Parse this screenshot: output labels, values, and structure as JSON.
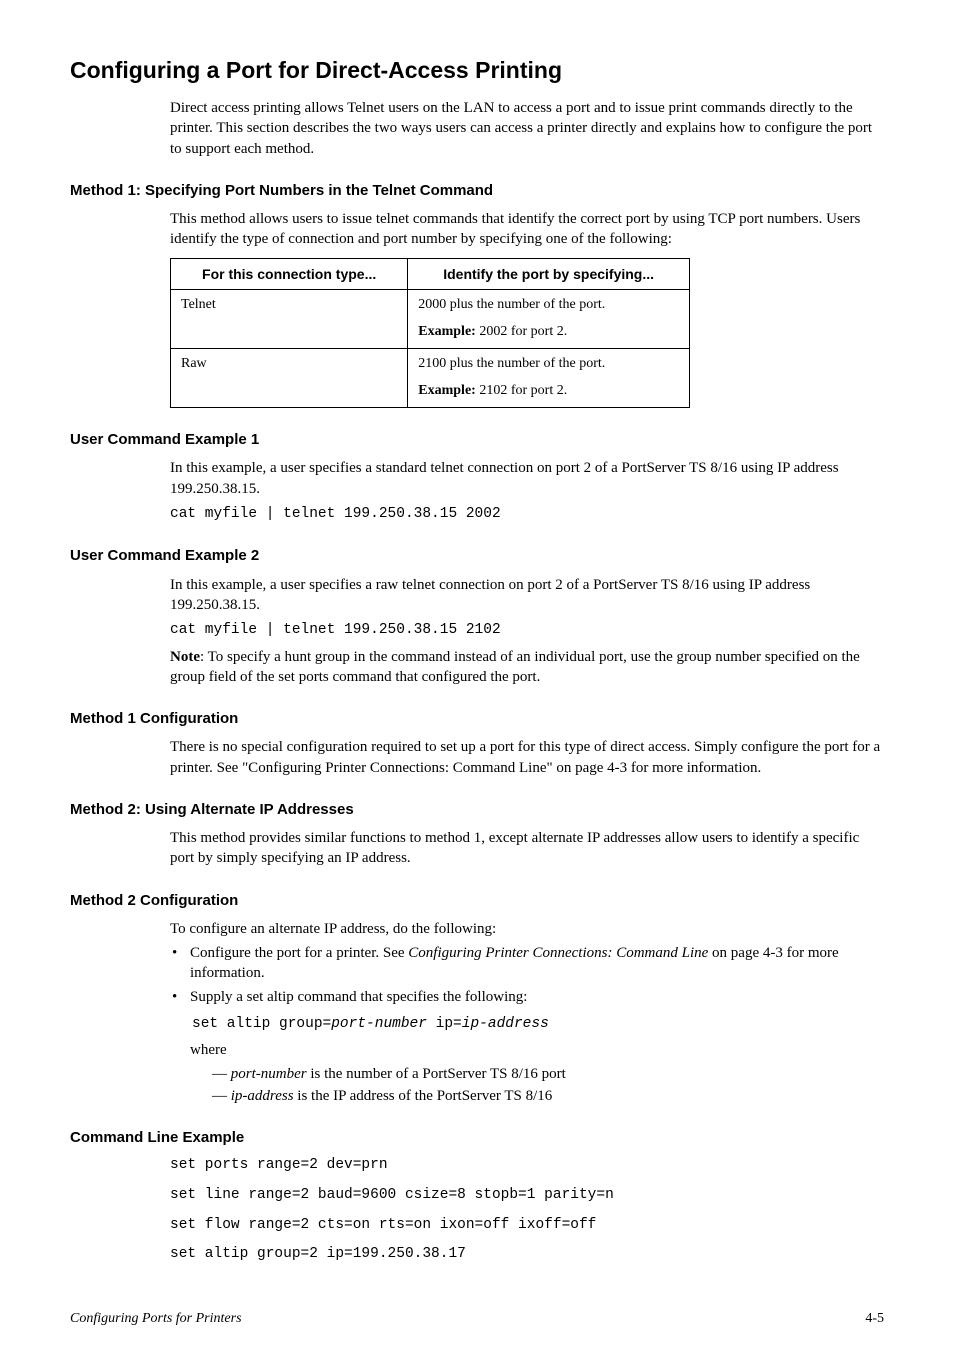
{
  "title": "Configuring a Port for Direct-Access Printing",
  "intro": "Direct access printing allows Telnet users on the LAN to access a port and to issue print commands directly to the printer. This section describes the two ways users can access a printer directly and explains how to configure the port to support each method.",
  "method1": {
    "heading": "Method 1: Specifying Port Numbers in the Telnet Command",
    "desc": "This method allows users to issue telnet commands that identify the correct port by using TCP port numbers. Users identify the type of connection and port number by specifying one of the following:",
    "table": {
      "h1": "For this connection type...",
      "h2": "Identify the port by specifying...",
      "rows": [
        {
          "c1": "Telnet",
          "c2a": "2000 plus the number of the port.",
          "c2b_label": "Example:",
          "c2b_text": " 2002 for port 2."
        },
        {
          "c1": "Raw",
          "c2a": "2100 plus the number of the port.",
          "c2b_label": "Example:",
          "c2b_text": " 2102 for port 2."
        }
      ]
    }
  },
  "ex1": {
    "heading": "User Command Example 1",
    "desc": "In this example, a user specifies a standard telnet connection on port 2 of a PortServer TS 8/16 using IP address 199.250.38.15.",
    "code": "cat myfile | telnet 199.250.38.15 2002"
  },
  "ex2": {
    "heading": "User Command Example 2",
    "desc": "In this example, a user specifies a raw telnet connection on port 2 of a PortServer TS 8/16 using IP address 199.250.38.15.",
    "code": "cat myfile | telnet 199.250.38.15 2102",
    "note_label": "Note",
    "note_text": ": To specify a hunt group in the command instead of an individual port, use the group number specified on the group field of the set ports command that configured the port."
  },
  "m1cfg": {
    "heading": "Method 1 Configuration",
    "desc": "There is no special configuration required to set up a port for this type of direct access. Simply configure the port for a printer. See \"Configuring Printer Connections: Command Line\" on page 4-3 for more information."
  },
  "method2": {
    "heading": "Method 2: Using Alternate IP Addresses",
    "desc": "This method provides similar functions to method 1, except alternate IP addresses allow users to identify a specific port by simply specifying an IP address."
  },
  "m2cfg": {
    "heading": "Method 2 Configuration",
    "lead": "To configure an alternate IP address, do the following:",
    "b1a": "Configure the port for a printer. See ",
    "b1b": "Configuring Printer Connections: Command Line",
    "b1c": " on page 4-3 for more information.",
    "b2": "Supply a set altip command that specifies the following:",
    "code_pre": "set altip group=",
    "code_var1": "port-number",
    "code_mid": " ip=",
    "code_var2": "ip-address",
    "where": "where",
    "s1_pre": "— ",
    "s1_var": "port-number",
    "s1_post": " is the number of a PortServer TS 8/16 port",
    "s2_pre": "— ",
    "s2_var": "ip-address",
    "s2_post": " is the IP address of the PortServer TS 8/16"
  },
  "cli": {
    "heading": "Command Line Example",
    "l1": "set ports range=2 dev=prn",
    "l2": "set line range=2 baud=9600 csize=8 stopb=1 parity=n",
    "l3": "set flow range=2 cts=on rts=on ixon=off ixoff=off",
    "l4": "set altip group=2 ip=199.250.38.17"
  },
  "footer": {
    "left": "Configuring Ports for Printers",
    "right": "4-5"
  }
}
